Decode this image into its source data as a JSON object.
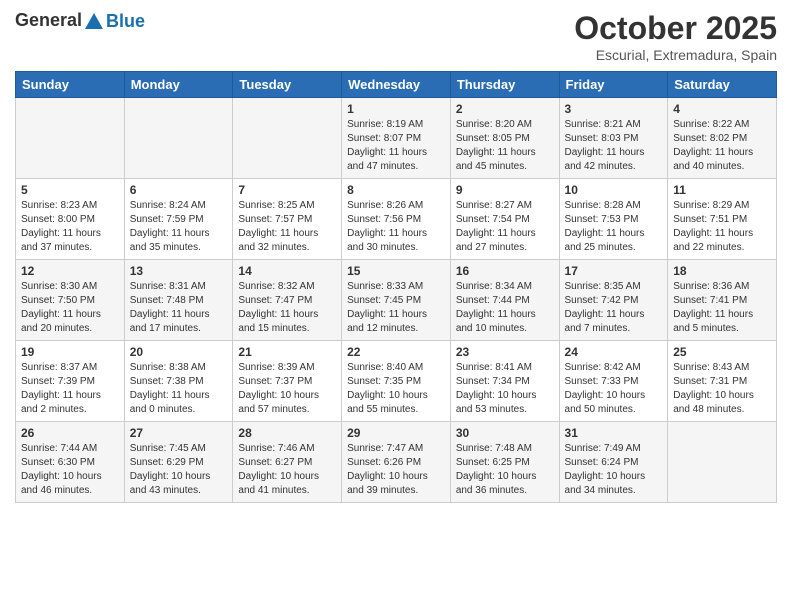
{
  "header": {
    "logo_general": "General",
    "logo_blue": "Blue",
    "month": "October 2025",
    "location": "Escurial, Extremadura, Spain"
  },
  "days_of_week": [
    "Sunday",
    "Monday",
    "Tuesday",
    "Wednesday",
    "Thursday",
    "Friday",
    "Saturday"
  ],
  "weeks": [
    [
      {
        "day": "",
        "info": ""
      },
      {
        "day": "",
        "info": ""
      },
      {
        "day": "",
        "info": ""
      },
      {
        "day": "1",
        "info": "Sunrise: 8:19 AM\nSunset: 8:07 PM\nDaylight: 11 hours and 47 minutes."
      },
      {
        "day": "2",
        "info": "Sunrise: 8:20 AM\nSunset: 8:05 PM\nDaylight: 11 hours and 45 minutes."
      },
      {
        "day": "3",
        "info": "Sunrise: 8:21 AM\nSunset: 8:03 PM\nDaylight: 11 hours and 42 minutes."
      },
      {
        "day": "4",
        "info": "Sunrise: 8:22 AM\nSunset: 8:02 PM\nDaylight: 11 hours and 40 minutes."
      }
    ],
    [
      {
        "day": "5",
        "info": "Sunrise: 8:23 AM\nSunset: 8:00 PM\nDaylight: 11 hours and 37 minutes."
      },
      {
        "day": "6",
        "info": "Sunrise: 8:24 AM\nSunset: 7:59 PM\nDaylight: 11 hours and 35 minutes."
      },
      {
        "day": "7",
        "info": "Sunrise: 8:25 AM\nSunset: 7:57 PM\nDaylight: 11 hours and 32 minutes."
      },
      {
        "day": "8",
        "info": "Sunrise: 8:26 AM\nSunset: 7:56 PM\nDaylight: 11 hours and 30 minutes."
      },
      {
        "day": "9",
        "info": "Sunrise: 8:27 AM\nSunset: 7:54 PM\nDaylight: 11 hours and 27 minutes."
      },
      {
        "day": "10",
        "info": "Sunrise: 8:28 AM\nSunset: 7:53 PM\nDaylight: 11 hours and 25 minutes."
      },
      {
        "day": "11",
        "info": "Sunrise: 8:29 AM\nSunset: 7:51 PM\nDaylight: 11 hours and 22 minutes."
      }
    ],
    [
      {
        "day": "12",
        "info": "Sunrise: 8:30 AM\nSunset: 7:50 PM\nDaylight: 11 hours and 20 minutes."
      },
      {
        "day": "13",
        "info": "Sunrise: 8:31 AM\nSunset: 7:48 PM\nDaylight: 11 hours and 17 minutes."
      },
      {
        "day": "14",
        "info": "Sunrise: 8:32 AM\nSunset: 7:47 PM\nDaylight: 11 hours and 15 minutes."
      },
      {
        "day": "15",
        "info": "Sunrise: 8:33 AM\nSunset: 7:45 PM\nDaylight: 11 hours and 12 minutes."
      },
      {
        "day": "16",
        "info": "Sunrise: 8:34 AM\nSunset: 7:44 PM\nDaylight: 11 hours and 10 minutes."
      },
      {
        "day": "17",
        "info": "Sunrise: 8:35 AM\nSunset: 7:42 PM\nDaylight: 11 hours and 7 minutes."
      },
      {
        "day": "18",
        "info": "Sunrise: 8:36 AM\nSunset: 7:41 PM\nDaylight: 11 hours and 5 minutes."
      }
    ],
    [
      {
        "day": "19",
        "info": "Sunrise: 8:37 AM\nSunset: 7:39 PM\nDaylight: 11 hours and 2 minutes."
      },
      {
        "day": "20",
        "info": "Sunrise: 8:38 AM\nSunset: 7:38 PM\nDaylight: 11 hours and 0 minutes."
      },
      {
        "day": "21",
        "info": "Sunrise: 8:39 AM\nSunset: 7:37 PM\nDaylight: 10 hours and 57 minutes."
      },
      {
        "day": "22",
        "info": "Sunrise: 8:40 AM\nSunset: 7:35 PM\nDaylight: 10 hours and 55 minutes."
      },
      {
        "day": "23",
        "info": "Sunrise: 8:41 AM\nSunset: 7:34 PM\nDaylight: 10 hours and 53 minutes."
      },
      {
        "day": "24",
        "info": "Sunrise: 8:42 AM\nSunset: 7:33 PM\nDaylight: 10 hours and 50 minutes."
      },
      {
        "day": "25",
        "info": "Sunrise: 8:43 AM\nSunset: 7:31 PM\nDaylight: 10 hours and 48 minutes."
      }
    ],
    [
      {
        "day": "26",
        "info": "Sunrise: 7:44 AM\nSunset: 6:30 PM\nDaylight: 10 hours and 46 minutes."
      },
      {
        "day": "27",
        "info": "Sunrise: 7:45 AM\nSunset: 6:29 PM\nDaylight: 10 hours and 43 minutes."
      },
      {
        "day": "28",
        "info": "Sunrise: 7:46 AM\nSunset: 6:27 PM\nDaylight: 10 hours and 41 minutes."
      },
      {
        "day": "29",
        "info": "Sunrise: 7:47 AM\nSunset: 6:26 PM\nDaylight: 10 hours and 39 minutes."
      },
      {
        "day": "30",
        "info": "Sunrise: 7:48 AM\nSunset: 6:25 PM\nDaylight: 10 hours and 36 minutes."
      },
      {
        "day": "31",
        "info": "Sunrise: 7:49 AM\nSunset: 6:24 PM\nDaylight: 10 hours and 34 minutes."
      },
      {
        "day": "",
        "info": ""
      }
    ]
  ]
}
